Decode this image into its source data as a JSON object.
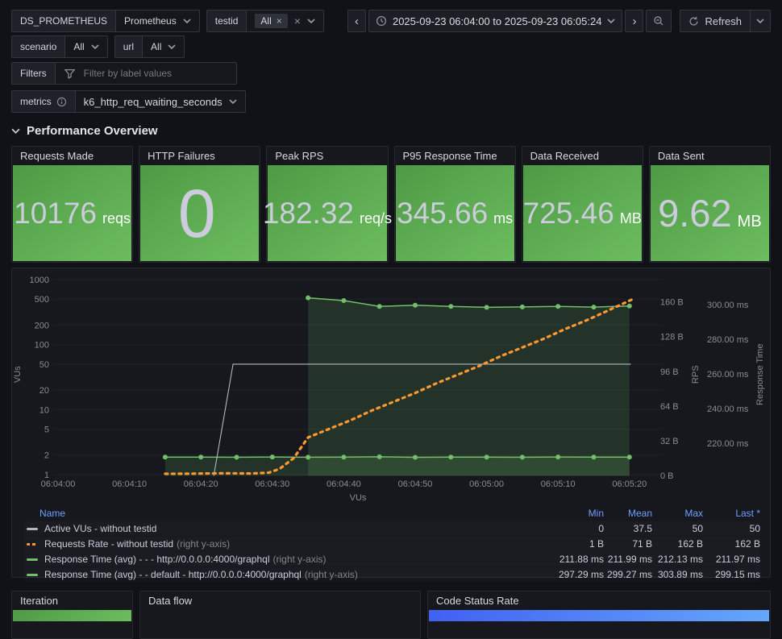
{
  "toolbar": {
    "datasource": {
      "label": "DS_PROMETHEUS",
      "value": "Prometheus"
    },
    "testid": {
      "label": "testid",
      "pill": "All"
    },
    "scenario": {
      "label": "scenario",
      "value": "All"
    },
    "url": {
      "label": "url",
      "value": "All"
    },
    "filters": {
      "label": "Filters",
      "placeholder": "Filter by label values"
    },
    "metrics": {
      "label": "metrics",
      "value": "k6_http_req_waiting_seconds"
    },
    "time_range": "2025-09-23 06:04:00 to 2025-09-23 06:05:24",
    "refresh_label": "Refresh"
  },
  "icons": {
    "prev": "‹",
    "next": "›",
    "close": "×"
  },
  "section": {
    "title": "Performance Overview"
  },
  "stats": [
    {
      "title": "Requests Made",
      "value": "10176",
      "unit": "reqs"
    },
    {
      "title": "HTTP Failures",
      "value": "0",
      "unit": ""
    },
    {
      "title": "Peak RPS",
      "value": "182.32",
      "unit": "req/s"
    },
    {
      "title": "P95 Response Time",
      "value": "345.66",
      "unit": "ms"
    },
    {
      "title": "Data Received",
      "value": "725.46",
      "unit": "MB"
    },
    {
      "title": "Data Sent",
      "value": "9.62",
      "unit": "MB"
    }
  ],
  "chart_data": {
    "type": "line",
    "x_label": "VUs",
    "x_unit": "time, seconds after 06:04:00",
    "x_range": [
      0,
      84.5
    ],
    "x_ticks": [
      {
        "t": 0,
        "label": "06:04:00"
      },
      {
        "t": 10,
        "label": "06:04:10"
      },
      {
        "t": 20,
        "label": "06:04:20"
      },
      {
        "t": 30,
        "label": "06:04:30"
      },
      {
        "t": 40,
        "label": "06:04:40"
      },
      {
        "t": 50,
        "label": "06:04:50"
      },
      {
        "t": 60,
        "label": "06:05:00"
      },
      {
        "t": 70,
        "label": "06:05:10"
      },
      {
        "t": 80,
        "label": "06:05:20"
      }
    ],
    "axes": {
      "left_log": {
        "label": "VUs",
        "scale": "log10",
        "range": [
          1,
          1000
        ],
        "ticks": [
          1000,
          500,
          200,
          100,
          50,
          20,
          10,
          5,
          2,
          1
        ]
      },
      "right_bytes": {
        "label": "RPS",
        "scale": "linear",
        "range": [
          0,
          187
        ],
        "ticks": [
          {
            "v": 160,
            "label": "160 B"
          },
          {
            "v": 128,
            "label": "128 B"
          },
          {
            "v": 96,
            "label": "96 B"
          },
          {
            "v": 64,
            "label": "64 B"
          },
          {
            "v": 32,
            "label": "32 B"
          },
          {
            "v": 0,
            "label": "0 B"
          }
        ]
      },
      "right_ms": {
        "label": "Response Time",
        "scale": "linear",
        "range": [
          201,
          318
        ],
        "ticks": [
          {
            "v": 300,
            "label": "300.00 ms"
          },
          {
            "v": 280,
            "label": "280.00 ms"
          },
          {
            "v": 260,
            "label": "260.00 ms"
          },
          {
            "v": 240,
            "label": "240.00 ms"
          },
          {
            "v": 220,
            "label": "220.00 ms"
          }
        ]
      }
    },
    "series": [
      {
        "name": "Response Time (avg) - - - http://0.0.0.0:4000/graphql",
        "axis": "right_ms",
        "color_key": "green",
        "style": "solid",
        "width": 1.5,
        "markers": true,
        "fill": 0.16,
        "points": [
          [
            15,
            211.95
          ],
          [
            20,
            212.0
          ],
          [
            25,
            211.9
          ],
          [
            30,
            212.05
          ],
          [
            35,
            211.9
          ],
          [
            40,
            211.95
          ],
          [
            45,
            212.13
          ],
          [
            50,
            211.88
          ],
          [
            55,
            211.95
          ],
          [
            60,
            212.0
          ],
          [
            65,
            211.9
          ],
          [
            70,
            212.05
          ],
          [
            75,
            211.95
          ],
          [
            80,
            211.97
          ]
        ]
      },
      {
        "name": "Response Time (avg) - - default - http://0.0.0.0:4000/graphql",
        "axis": "right_ms",
        "color_key": "green",
        "style": "solid",
        "width": 1.5,
        "markers": true,
        "fill": 0.16,
        "points": [
          [
            35,
            303.89
          ],
          [
            40,
            302.3
          ],
          [
            45,
            298.9
          ],
          [
            50,
            299.6
          ],
          [
            55,
            298.9
          ],
          [
            60,
            298.4
          ],
          [
            65,
            298.6
          ],
          [
            70,
            298.9
          ],
          [
            75,
            298.5
          ],
          [
            80,
            299.15
          ]
        ]
      },
      {
        "name": "Active VUs - without testid",
        "axis": "left_log",
        "color_key": "gray_series",
        "style": "solid",
        "width": 1.1,
        "markers": false,
        "fill": 0,
        "points": [
          [
            21.8,
            0.95
          ],
          [
            24.5,
            50
          ],
          [
            80.2,
            50
          ]
        ]
      },
      {
        "name": "Requests Rate - without testid",
        "axis": "right_bytes",
        "color_key": "orange",
        "style": "dashed",
        "width": 3.2,
        "markers": false,
        "fill": 0,
        "points": [
          [
            15,
            1.5
          ],
          [
            19,
            1.6
          ],
          [
            23,
            2
          ],
          [
            27,
            1.8
          ],
          [
            29.5,
            2.5
          ],
          [
            31,
            6
          ],
          [
            33,
            16
          ],
          [
            35,
            35
          ],
          [
            38,
            43
          ],
          [
            41,
            51
          ],
          [
            44,
            60
          ],
          [
            47,
            68
          ],
          [
            50,
            76
          ],
          [
            53,
            85
          ],
          [
            56,
            93
          ],
          [
            59,
            101
          ],
          [
            62,
            110
          ],
          [
            65,
            118
          ],
          [
            68,
            126
          ],
          [
            71,
            135
          ],
          [
            74,
            143
          ],
          [
            77,
            152
          ],
          [
            80.3,
            162
          ]
        ]
      }
    ]
  },
  "legend": {
    "columns": [
      "Name",
      "Min",
      "Mean",
      "Max",
      "Last *"
    ],
    "rows": [
      {
        "name": "Active VUs - without testid",
        "suffix": "",
        "color_key": "gray_series",
        "style": "solid",
        "min": "0",
        "mean": "37.5",
        "max": "50",
        "last": "50"
      },
      {
        "name": "Requests Rate - without testid",
        "suffix": "(right y-axis)",
        "color_key": "orange",
        "style": "dashed",
        "min": "1 B",
        "mean": "71 B",
        "max": "162 B",
        "last": "162 B"
      },
      {
        "name": "Response Time (avg) - - - http://0.0.0.0:4000/graphql",
        "suffix": "(right y-axis)",
        "color_key": "green",
        "style": "solid",
        "min": "211.88 ms",
        "mean": "211.99 ms",
        "max": "212.13 ms",
        "last": "211.97 ms"
      },
      {
        "name": "Response Time (avg) - - default - http://0.0.0.0:4000/graphql",
        "suffix": "(right y-axis)",
        "color_key": "green",
        "style": "solid",
        "min": "297.29 ms",
        "mean": "299.27 ms",
        "max": "303.89 ms",
        "last": "299.15 ms"
      }
    ]
  },
  "bottom": [
    {
      "title": "Iteration",
      "bar": "green"
    },
    {
      "title": "Data flow",
      "bar": ""
    },
    {
      "title": "Code Status Rate",
      "bar": "blue"
    }
  ],
  "colors": {
    "green": "#73bf69",
    "orange": "#ff9830",
    "gray_series": "#b4b7bd",
    "link_blue": "#6e9fff",
    "stat_g1": "#4e9a45",
    "stat_g2": "#6cbd5f",
    "blue_g1": "#4161f2",
    "blue_g2": "#64a7fb"
  }
}
